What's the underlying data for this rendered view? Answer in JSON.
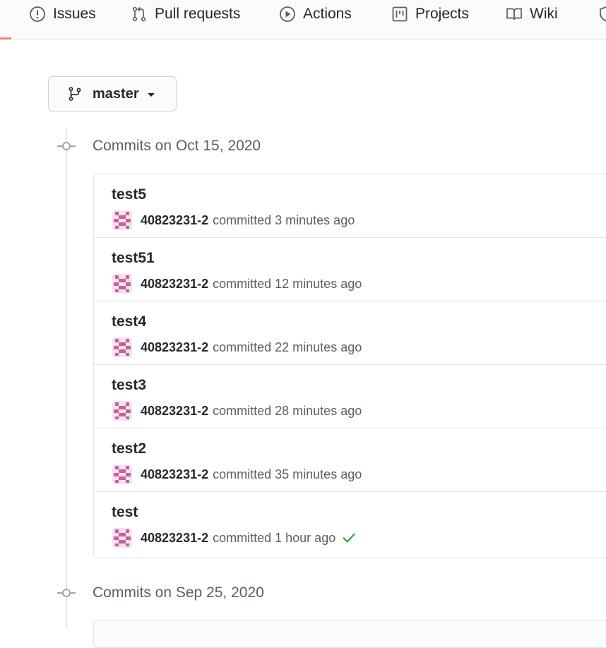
{
  "nav": {
    "items": [
      {
        "label": "Issues",
        "icon": "issue-opened-icon"
      },
      {
        "label": "Pull requests",
        "icon": "git-pull-request-icon"
      },
      {
        "label": "Actions",
        "icon": "play-icon"
      },
      {
        "label": "Projects",
        "icon": "project-icon"
      },
      {
        "label": "Wiki",
        "icon": "book-icon"
      }
    ],
    "active_underline_color": "#f9826c"
  },
  "branch": {
    "name": "master",
    "icon": "git-branch-icon"
  },
  "groups": [
    {
      "heading": "Commits on Oct 15, 2020",
      "commits": [
        {
          "title": "test5",
          "author": "40823231-2",
          "verb": "committed",
          "time": "3 minutes ago"
        },
        {
          "title": "test51",
          "author": "40823231-2",
          "verb": "committed",
          "time": "12 minutes ago"
        },
        {
          "title": "test4",
          "author": "40823231-2",
          "verb": "committed",
          "time": "22 minutes ago"
        },
        {
          "title": "test3",
          "author": "40823231-2",
          "verb": "committed",
          "time": "28 minutes ago"
        },
        {
          "title": "test2",
          "author": "40823231-2",
          "verb": "committed",
          "time": "35 minutes ago"
        },
        {
          "title": "test",
          "author": "40823231-2",
          "verb": "committed",
          "time": "1 hour ago",
          "status": "success-check-icon"
        }
      ]
    },
    {
      "heading": "Commits on Sep 25, 2020"
    }
  ],
  "colors": {
    "avatar": "#c9609d",
    "check": "#28a745"
  }
}
